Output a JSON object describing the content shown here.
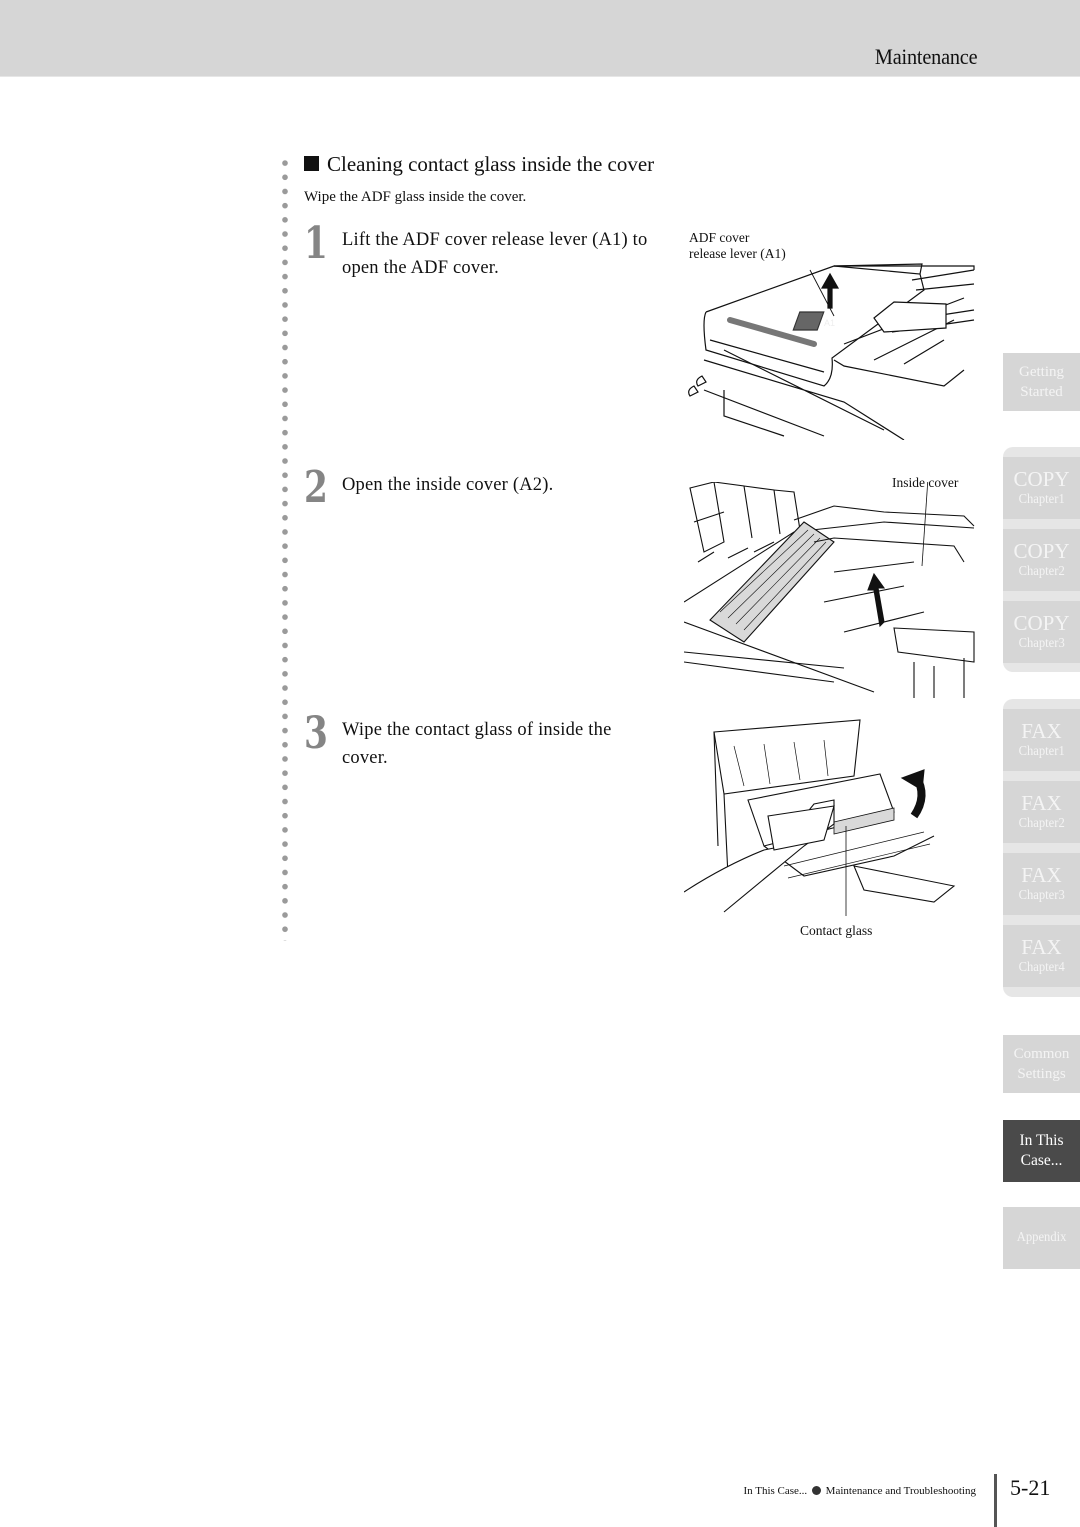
{
  "header": {
    "section_title": "Maintenance"
  },
  "section": {
    "title": "Cleaning contact glass inside the cover",
    "intro": "Wipe the ADF glass inside the cover."
  },
  "steps": [
    {
      "number": "1",
      "text": "Lift the ADF cover release lever (A1) to open the ADF cover.",
      "figure_label": "ADF cover release lever (A1)",
      "figure_label_lines": [
        "ADF cover",
        "release lever (A1)"
      ],
      "figure_tag": "A1"
    },
    {
      "number": "2",
      "text": "Open the inside cover (A2).",
      "figure_label": "Inside cover"
    },
    {
      "number": "3",
      "text": "Wipe the contact glass of inside the cover.",
      "figure_label": "Contact glass"
    }
  ],
  "side_tabs": [
    {
      "id": "getting-started",
      "lines": [
        "Getting",
        "Started"
      ],
      "active": false
    },
    {
      "id": "copy-ch1",
      "title": "COPY",
      "sub": "Chapter1",
      "active": false
    },
    {
      "id": "copy-ch2",
      "title": "COPY",
      "sub": "Chapter2",
      "active": false
    },
    {
      "id": "copy-ch3",
      "title": "COPY",
      "sub": "Chapter3",
      "active": false
    },
    {
      "id": "fax-ch1",
      "title": "FAX",
      "sub": "Chapter1",
      "active": false
    },
    {
      "id": "fax-ch2",
      "title": "FAX",
      "sub": "Chapter2",
      "active": false
    },
    {
      "id": "fax-ch3",
      "title": "FAX",
      "sub": "Chapter3",
      "active": false
    },
    {
      "id": "fax-ch4",
      "title": "FAX",
      "sub": "Chapter4",
      "active": false
    },
    {
      "id": "common-settings",
      "lines": [
        "Common",
        "Settings"
      ],
      "active": false
    },
    {
      "id": "in-this-case",
      "lines": [
        "In This",
        "Case..."
      ],
      "active": true
    },
    {
      "id": "appendix",
      "lines": [
        "Appendix"
      ],
      "active": false
    }
  ],
  "footer": {
    "breadcrumb_left": "In This Case...",
    "breadcrumb_right": "Maintenance and Troubleshooting",
    "page_number": "5-21"
  },
  "colors": {
    "header_band": "#d6d6d6",
    "tab_inactive": "#d6d6d6",
    "tab_group_bg": "#e6e6e6",
    "tab_active": "#4a4a4a",
    "step_number": "#858585"
  }
}
